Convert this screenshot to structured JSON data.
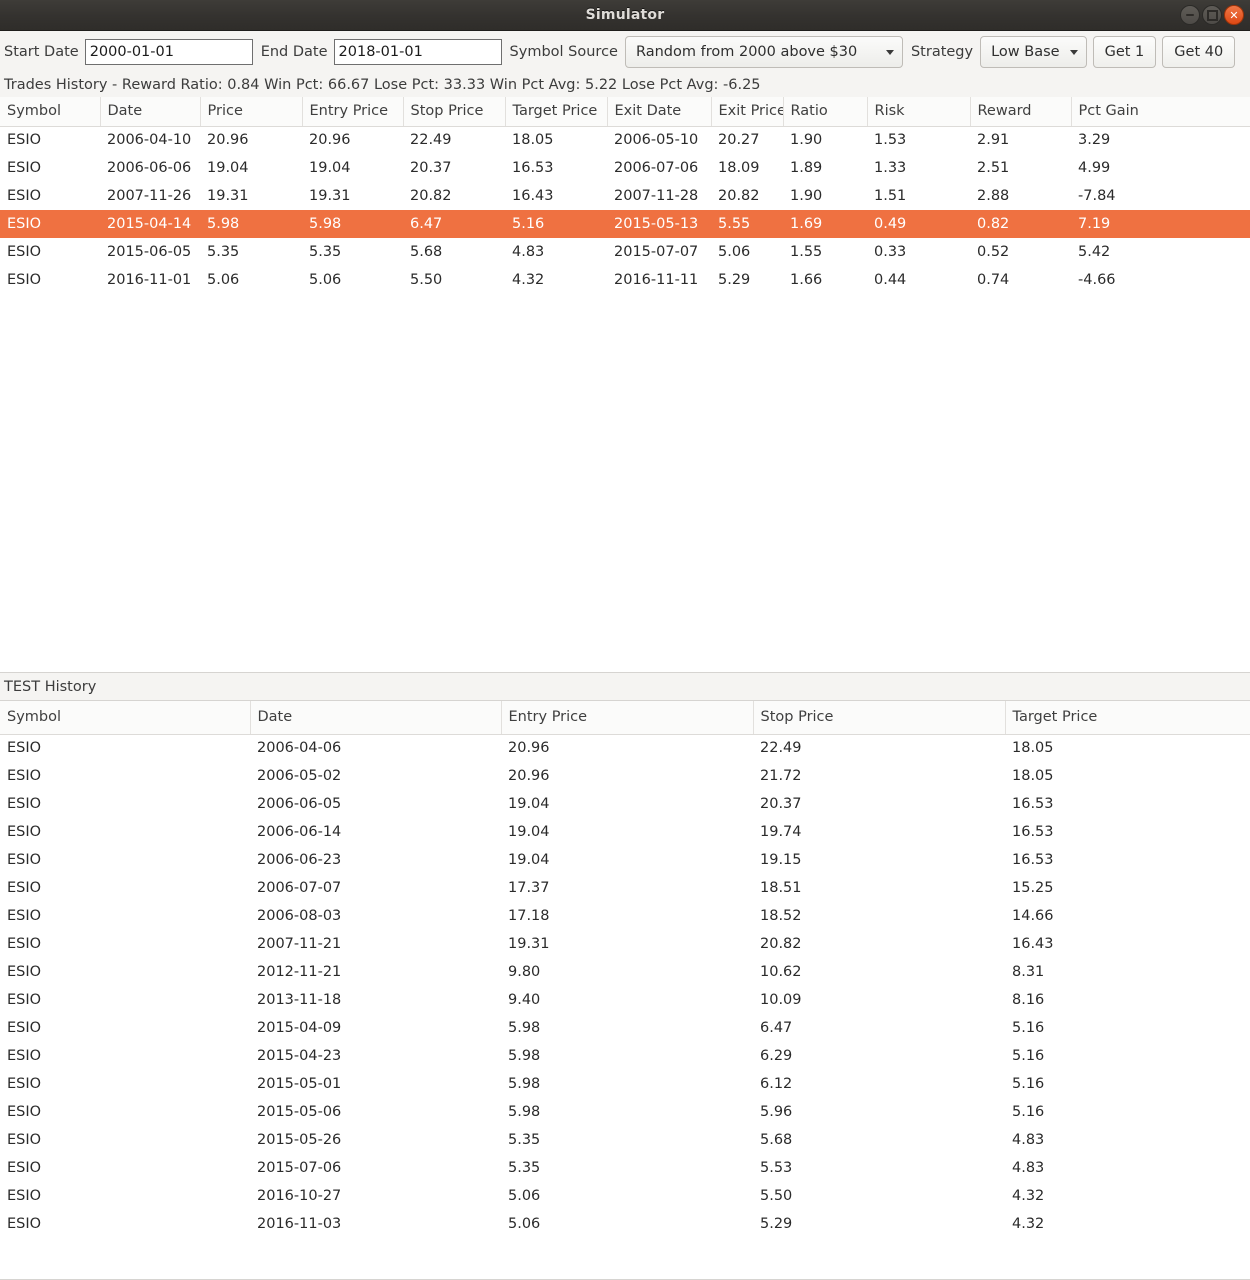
{
  "window": {
    "title": "Simulator",
    "controls": [
      {
        "name": "minimize-button",
        "glyph": "minus"
      },
      {
        "name": "maximize-button",
        "glyph": "square"
      },
      {
        "name": "close-button",
        "glyph": "×"
      }
    ]
  },
  "toolbar": {
    "start_date_label": "Start Date",
    "start_date_value": "2000-01-01",
    "start_date_placeholder": "",
    "end_date_label": "End Date",
    "end_date_value": "2018-01-01",
    "end_date_placeholder": "",
    "symbol_source_label": "Symbol Source",
    "symbol_source_value": "Random from 2000 above $30",
    "strategy_label": "Strategy",
    "strategy_value": "Low Base",
    "get1_label": "Get 1",
    "get40_label": "Get 40"
  },
  "status": {
    "text": "Trades History - Reward Ratio: 0.84 Win Pct: 66.67 Lose Pct: 33.33 Win Pct Avg: 5.22 Lose Pct Avg: -6.25",
    "reward_ratio": "0.84",
    "win_pct": "66.67",
    "lose_pct": "33.33",
    "win_pct_avg": "5.22",
    "lose_pct_avg": "-6.25"
  },
  "trades_table": {
    "columns": [
      "Symbol",
      "Date",
      "Price",
      "Entry Price",
      "Stop Price",
      "Target Price",
      "Exit Date",
      "Exit Price",
      "Ratio",
      "Risk",
      "Reward",
      "Pct Gain"
    ],
    "selected_row_index": 3,
    "rows": [
      [
        "ESIO",
        "2006-04-10",
        "20.96",
        "20.96",
        "22.49",
        "18.05",
        "2006-05-10",
        "20.27",
        "1.90",
        "1.53",
        "2.91",
        "3.29"
      ],
      [
        "ESIO",
        "2006-06-06",
        "19.04",
        "19.04",
        "20.37",
        "16.53",
        "2006-07-06",
        "18.09",
        "1.89",
        "1.33",
        "2.51",
        "4.99"
      ],
      [
        "ESIO",
        "2007-11-26",
        "19.31",
        "19.31",
        "20.82",
        "16.43",
        "2007-11-28",
        "20.82",
        "1.90",
        "1.51",
        "2.88",
        "-7.84"
      ],
      [
        "ESIO",
        "2015-04-14",
        "5.98",
        "5.98",
        "6.47",
        "5.16",
        "2015-05-13",
        "5.55",
        "1.69",
        "0.49",
        "0.82",
        "7.19"
      ],
      [
        "ESIO",
        "2015-06-05",
        "5.35",
        "5.35",
        "5.68",
        "4.83",
        "2015-07-07",
        "5.06",
        "1.55",
        "0.33",
        "0.52",
        "5.42"
      ],
      [
        "ESIO",
        "2016-11-01",
        "5.06",
        "5.06",
        "5.50",
        "4.32",
        "2016-11-11",
        "5.29",
        "1.66",
        "0.44",
        "0.74",
        "-4.66"
      ]
    ]
  },
  "test_section": {
    "label": "TEST History",
    "columns": [
      "Symbol",
      "Date",
      "Entry Price",
      "Stop Price",
      "Target Price"
    ],
    "rows": [
      [
        "ESIO",
        "2006-04-06",
        "20.96",
        "22.49",
        "18.05"
      ],
      [
        "ESIO",
        "2006-05-02",
        "20.96",
        "21.72",
        "18.05"
      ],
      [
        "ESIO",
        "2006-06-05",
        "19.04",
        "20.37",
        "16.53"
      ],
      [
        "ESIO",
        "2006-06-14",
        "19.04",
        "19.74",
        "16.53"
      ],
      [
        "ESIO",
        "2006-06-23",
        "19.04",
        "19.15",
        "16.53"
      ],
      [
        "ESIO",
        "2006-07-07",
        "17.37",
        "18.51",
        "15.25"
      ],
      [
        "ESIO",
        "2006-08-03",
        "17.18",
        "18.52",
        "14.66"
      ],
      [
        "ESIO",
        "2007-11-21",
        "19.31",
        "20.82",
        "16.43"
      ],
      [
        "ESIO",
        "2012-11-21",
        "9.80",
        "10.62",
        "8.31"
      ],
      [
        "ESIO",
        "2013-11-18",
        "9.40",
        "10.09",
        "8.16"
      ],
      [
        "ESIO",
        "2015-04-09",
        "5.98",
        "6.47",
        "5.16"
      ],
      [
        "ESIO",
        "2015-04-23",
        "5.98",
        "6.29",
        "5.16"
      ],
      [
        "ESIO",
        "2015-05-01",
        "5.98",
        "6.12",
        "5.16"
      ],
      [
        "ESIO",
        "2015-05-06",
        "5.98",
        "5.96",
        "5.16"
      ],
      [
        "ESIO",
        "2015-05-26",
        "5.35",
        "5.68",
        "4.83"
      ],
      [
        "ESIO",
        "2015-07-06",
        "5.35",
        "5.53",
        "4.83"
      ],
      [
        "ESIO",
        "2016-10-27",
        "5.06",
        "5.50",
        "4.32"
      ],
      [
        "ESIO",
        "2016-11-03",
        "5.06",
        "5.29",
        "4.32"
      ]
    ]
  },
  "colors": {
    "selection": "#ef7141",
    "titlebar": "#34322f",
    "close_button": "#dd4814",
    "window_bg": "#f5f4f2",
    "table_bg": "#ffffff"
  }
}
